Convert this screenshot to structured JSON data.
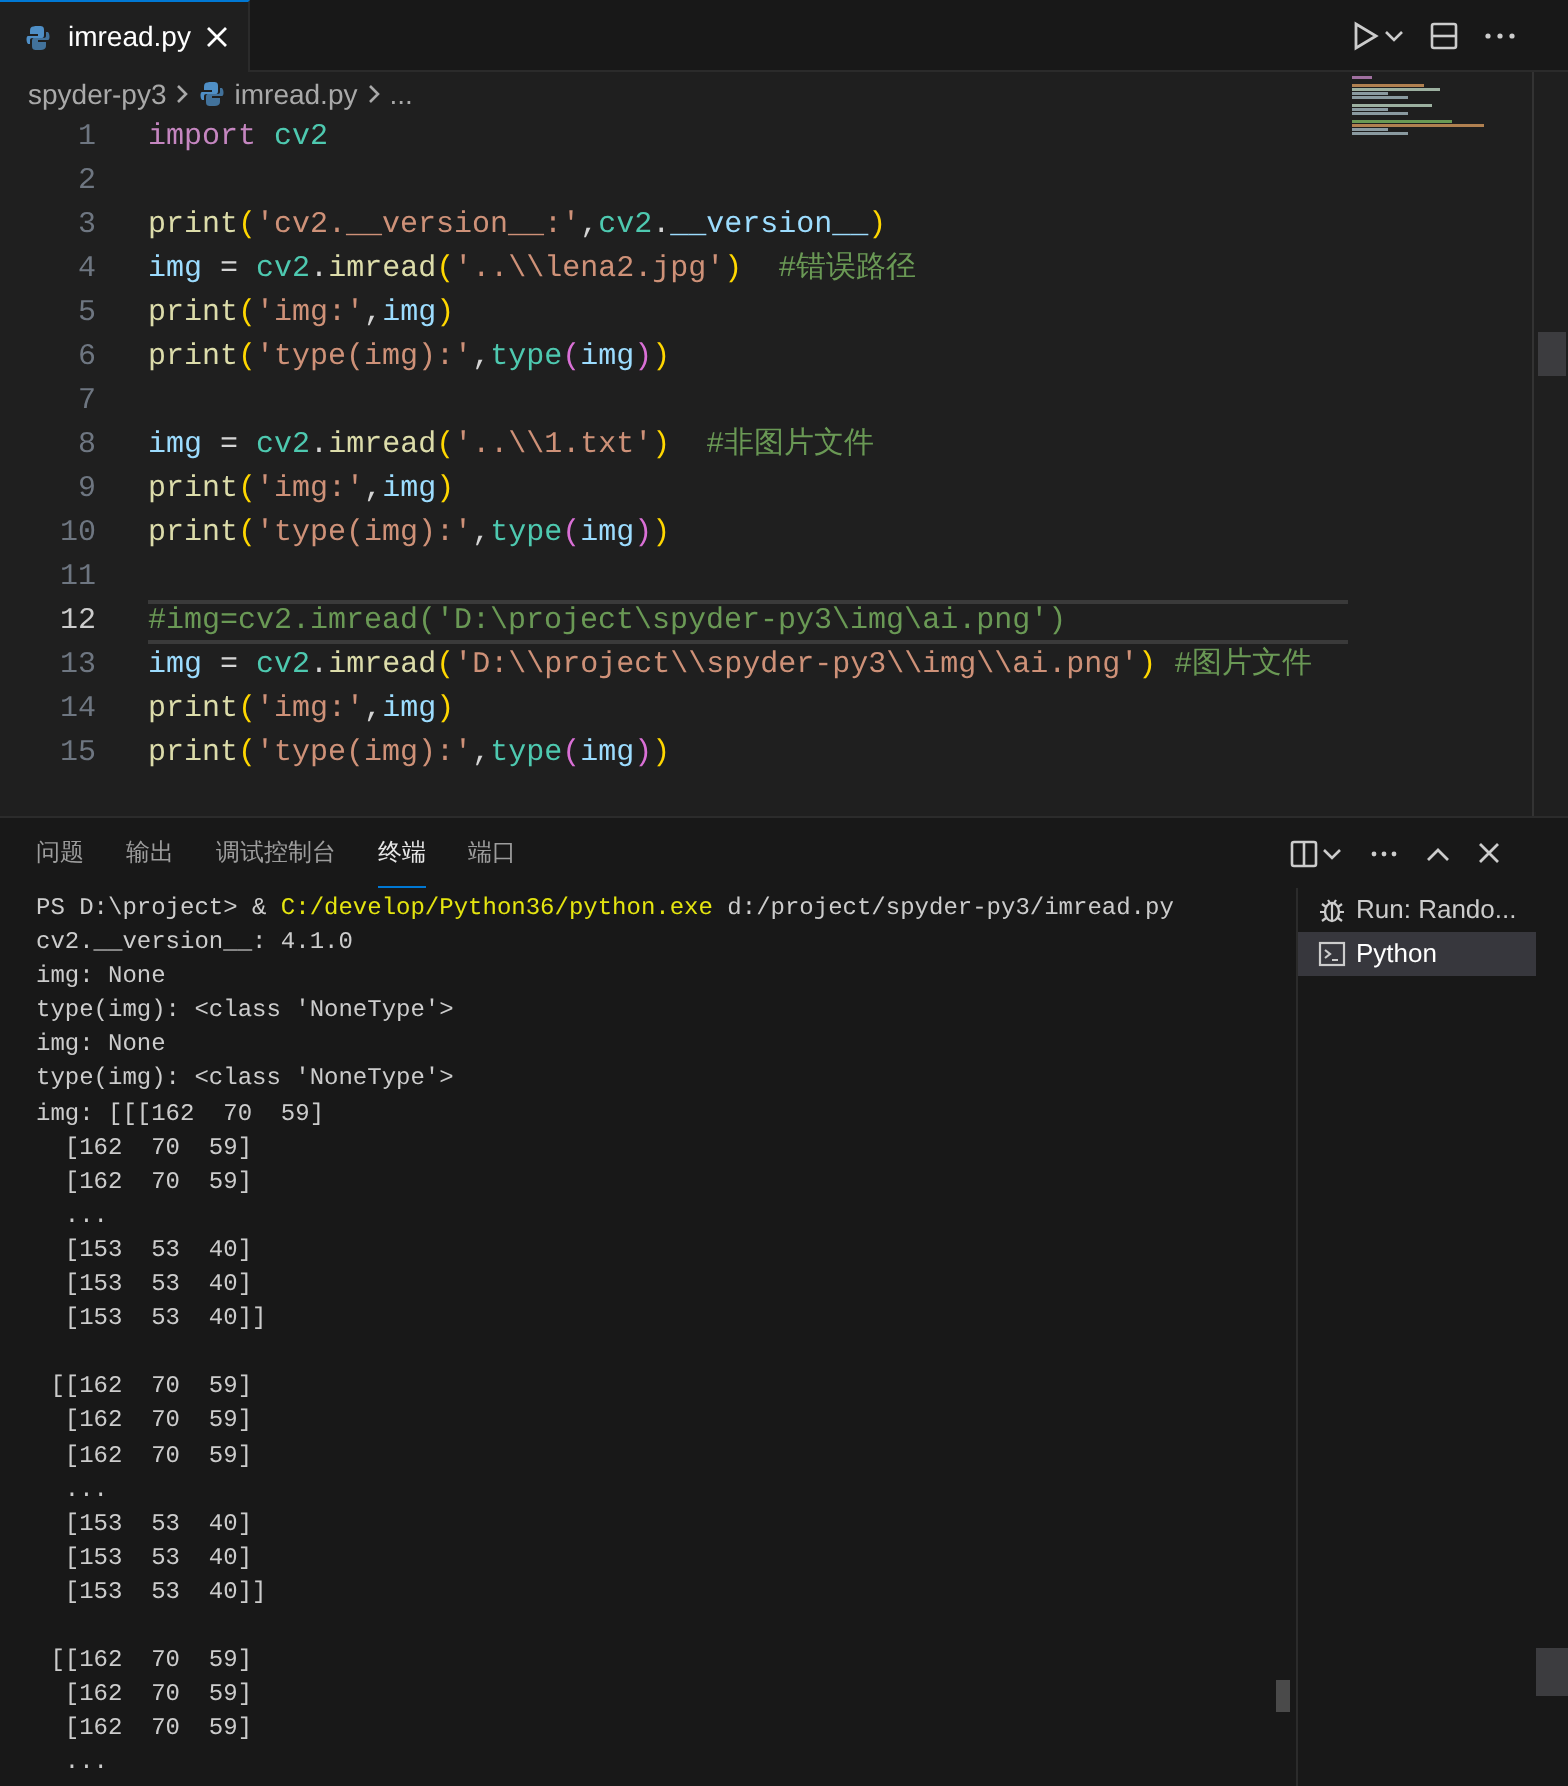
{
  "editor_tabs": [
    {
      "label": "imread.py",
      "selected": true
    }
  ],
  "breadcrumb": [
    "spyder-py3",
    "imread.py",
    "..."
  ],
  "code_lines": [
    {
      "number": "1",
      "current": false,
      "tokens": [
        {
          "kind": "keyword",
          "text": "import"
        },
        {
          "kind": "module",
          "text": " cv2"
        }
      ]
    },
    {
      "number": "2",
      "current": false
    },
    {
      "number": "3",
      "current": false,
      "tokens": [
        {
          "kind": "func",
          "text": "print"
        },
        {
          "kind": "paren1",
          "text": "("
        },
        {
          "kind": "string",
          "text": "'cv2.__version__:'"
        },
        {
          "kind": "op",
          "text": ","
        },
        {
          "kind": "module",
          "text": "cv2"
        },
        {
          "kind": "op",
          "text": "."
        },
        {
          "kind": "var",
          "text": "__version__"
        },
        {
          "kind": "paren1",
          "text": ")"
        }
      ]
    },
    {
      "number": "4",
      "current": false,
      "tokens": [
        {
          "kind": "var",
          "text": "img"
        },
        {
          "kind": "op",
          "text": " = "
        },
        {
          "kind": "module",
          "text": "cv2"
        },
        {
          "kind": "op",
          "text": "."
        },
        {
          "kind": "func",
          "text": "imread"
        },
        {
          "kind": "paren1",
          "text": "("
        },
        {
          "kind": "string",
          "text": "'..\\\\lena2.jpg'"
        },
        {
          "kind": "paren1",
          "text": ")"
        },
        {
          "kind": "comment",
          "text": "  #错误路径"
        }
      ]
    },
    {
      "number": "5",
      "current": false,
      "tokens": [
        {
          "kind": "func",
          "text": "print"
        },
        {
          "kind": "paren1",
          "text": "("
        },
        {
          "kind": "string",
          "text": "'img:'"
        },
        {
          "kind": "op",
          "text": ","
        },
        {
          "kind": "var",
          "text": "img"
        },
        {
          "kind": "paren1",
          "text": ")"
        }
      ]
    },
    {
      "number": "6",
      "current": false,
      "tokens": [
        {
          "kind": "func",
          "text": "print"
        },
        {
          "kind": "paren1",
          "text": "("
        },
        {
          "kind": "string",
          "text": "'type(img):'"
        },
        {
          "kind": "op",
          "text": ","
        },
        {
          "kind": "builtin",
          "text": "type"
        },
        {
          "kind": "paren2",
          "text": "("
        },
        {
          "kind": "var",
          "text": "img"
        },
        {
          "kind": "paren2",
          "text": ")"
        },
        {
          "kind": "paren1",
          "text": ")"
        }
      ]
    },
    {
      "number": "7",
      "current": false
    },
    {
      "number": "8",
      "current": false,
      "tokens": [
        {
          "kind": "var",
          "text": "img"
        },
        {
          "kind": "op",
          "text": " = "
        },
        {
          "kind": "module",
          "text": "cv2"
        },
        {
          "kind": "op",
          "text": "."
        },
        {
          "kind": "func",
          "text": "imread"
        },
        {
          "kind": "paren1",
          "text": "("
        },
        {
          "kind": "string",
          "text": "'..\\\\1.txt'"
        },
        {
          "kind": "paren1",
          "text": ")"
        },
        {
          "kind": "comment",
          "text": "  #非图片文件"
        }
      ]
    },
    {
      "number": "9",
      "current": false,
      "tokens": [
        {
          "kind": "func",
          "text": "print"
        },
        {
          "kind": "paren1",
          "text": "("
        },
        {
          "kind": "string",
          "text": "'img:'"
        },
        {
          "kind": "op",
          "text": ","
        },
        {
          "kind": "var",
          "text": "img"
        },
        {
          "kind": "paren1",
          "text": ")"
        }
      ]
    },
    {
      "number": "10",
      "current": false,
      "tokens": [
        {
          "kind": "func",
          "text": "print"
        },
        {
          "kind": "paren1",
          "text": "("
        },
        {
          "kind": "string",
          "text": "'type(img):'"
        },
        {
          "kind": "op",
          "text": ","
        },
        {
          "kind": "builtin",
          "text": "type"
        },
        {
          "kind": "paren2",
          "text": "("
        },
        {
          "kind": "var",
          "text": "img"
        },
        {
          "kind": "paren2",
          "text": ")"
        },
        {
          "kind": "paren1",
          "text": ")"
        }
      ]
    },
    {
      "number": "11",
      "current": false
    },
    {
      "number": "12",
      "current": true,
      "tokens": [
        {
          "kind": "comment",
          "text": "#img=cv2.imread('D:\\project\\spyder-py3\\img\\ai.png')"
        }
      ]
    },
    {
      "number": "13",
      "current": false,
      "tokens": [
        {
          "kind": "var",
          "text": "img"
        },
        {
          "kind": "op",
          "text": " = "
        },
        {
          "kind": "module",
          "text": "cv2"
        },
        {
          "kind": "op",
          "text": "."
        },
        {
          "kind": "func",
          "text": "imread"
        },
        {
          "kind": "paren1",
          "text": "("
        },
        {
          "kind": "string",
          "text": "'D:\\\\project\\\\spyder-py3\\\\img\\\\ai.png'"
        },
        {
          "kind": "paren1",
          "text": ")"
        },
        {
          "kind": "comment",
          "text": " #图片文件"
        }
      ]
    },
    {
      "number": "14",
      "current": false,
      "tokens": [
        {
          "kind": "func",
          "text": "print"
        },
        {
          "kind": "paren1",
          "text": "("
        },
        {
          "kind": "string",
          "text": "'img:'"
        },
        {
          "kind": "op",
          "text": ","
        },
        {
          "kind": "var",
          "text": "img"
        },
        {
          "kind": "paren1",
          "text": ")"
        }
      ]
    },
    {
      "number": "15",
      "current": false,
      "tokens": [
        {
          "kind": "func",
          "text": "print"
        },
        {
          "kind": "paren1",
          "text": "("
        },
        {
          "kind": "string",
          "text": "'type(img):'"
        },
        {
          "kind": "op",
          "text": ","
        },
        {
          "kind": "builtin",
          "text": "type"
        },
        {
          "kind": "paren2",
          "text": "("
        },
        {
          "kind": "var",
          "text": "img"
        },
        {
          "kind": "paren2",
          "text": ")"
        },
        {
          "kind": "paren1",
          "text": ")"
        }
      ]
    }
  ],
  "panel_tabs": [
    {
      "label": "问题",
      "selected": false
    },
    {
      "label": "输出",
      "selected": false
    },
    {
      "label": "调试控制台",
      "selected": false
    },
    {
      "label": "终端",
      "selected": true
    },
    {
      "label": "端口",
      "selected": false
    }
  ],
  "terminal_lines": [
    {
      "kind": "output",
      "segments": [
        {
          "kind": "plain",
          "text": "PS D:\\project> & "
        },
        {
          "kind": "command",
          "text": "C:/develop/Python36/python.exe"
        },
        {
          "kind": "plain",
          "text": " d:/project/spyder-py3/imread.py"
        }
      ]
    },
    {
      "kind": "output",
      "segments": [
        {
          "kind": "plain",
          "text": "cv2.__version__: 4.1.0"
        }
      ]
    },
    {
      "kind": "output",
      "segments": [
        {
          "kind": "plain",
          "text": "img: None"
        }
      ]
    },
    {
      "kind": "output",
      "segments": [
        {
          "kind": "plain",
          "text": "type(img): <class 'NoneType'>"
        }
      ]
    },
    {
      "kind": "output",
      "segments": [
        {
          "kind": "plain",
          "text": "img: None"
        }
      ]
    },
    {
      "kind": "output",
      "segments": [
        {
          "kind": "plain",
          "text": "type(img): <class 'NoneType'>"
        }
      ]
    },
    {
      "kind": "output",
      "segments": [
        {
          "kind": "plain",
          "text": "img: [[[162  70  59]"
        }
      ]
    },
    {
      "kind": "output",
      "segments": [
        {
          "kind": "plain",
          "text": "  [162  70  59]"
        }
      ]
    },
    {
      "kind": "output",
      "segments": [
        {
          "kind": "plain",
          "text": "  [162  70  59]"
        }
      ]
    },
    {
      "kind": "output",
      "segments": [
        {
          "kind": "plain",
          "text": "  ..."
        }
      ]
    },
    {
      "kind": "output",
      "segments": [
        {
          "kind": "plain",
          "text": "  [153  53  40]"
        }
      ]
    },
    {
      "kind": "output",
      "segments": [
        {
          "kind": "plain",
          "text": "  [153  53  40]"
        }
      ]
    },
    {
      "kind": "output",
      "segments": [
        {
          "kind": "plain",
          "text": "  [153  53  40]]"
        }
      ]
    },
    {
      "kind": "blank"
    },
    {
      "kind": "output",
      "segments": [
        {
          "kind": "plain",
          "text": " [[162  70  59]"
        }
      ]
    },
    {
      "kind": "output",
      "segments": [
        {
          "kind": "plain",
          "text": "  [162  70  59]"
        }
      ]
    },
    {
      "kind": "output",
      "segments": [
        {
          "kind": "plain",
          "text": "  [162  70  59]"
        }
      ]
    },
    {
      "kind": "output",
      "segments": [
        {
          "kind": "plain",
          "text": "  ..."
        }
      ]
    },
    {
      "kind": "output",
      "segments": [
        {
          "kind": "plain",
          "text": "  [153  53  40]"
        }
      ]
    },
    {
      "kind": "output",
      "segments": [
        {
          "kind": "plain",
          "text": "  [153  53  40]"
        }
      ]
    },
    {
      "kind": "output",
      "segments": [
        {
          "kind": "plain",
          "text": "  [153  53  40]]"
        }
      ]
    },
    {
      "kind": "blank"
    },
    {
      "kind": "output",
      "segments": [
        {
          "kind": "plain",
          "text": " [[162  70  59]"
        }
      ]
    },
    {
      "kind": "output",
      "segments": [
        {
          "kind": "plain",
          "text": "  [162  70  59]"
        }
      ]
    },
    {
      "kind": "output",
      "segments": [
        {
          "kind": "plain",
          "text": "  [162  70  59]"
        }
      ]
    },
    {
      "kind": "output",
      "segments": [
        {
          "kind": "plain",
          "text": "  ..."
        }
      ]
    }
  ],
  "terminal_sessions": [
    {
      "kind": "debug",
      "label": "Run: Rando...",
      "selected": false
    },
    {
      "kind": "shell",
      "label": "Python",
      "selected": true
    }
  ]
}
